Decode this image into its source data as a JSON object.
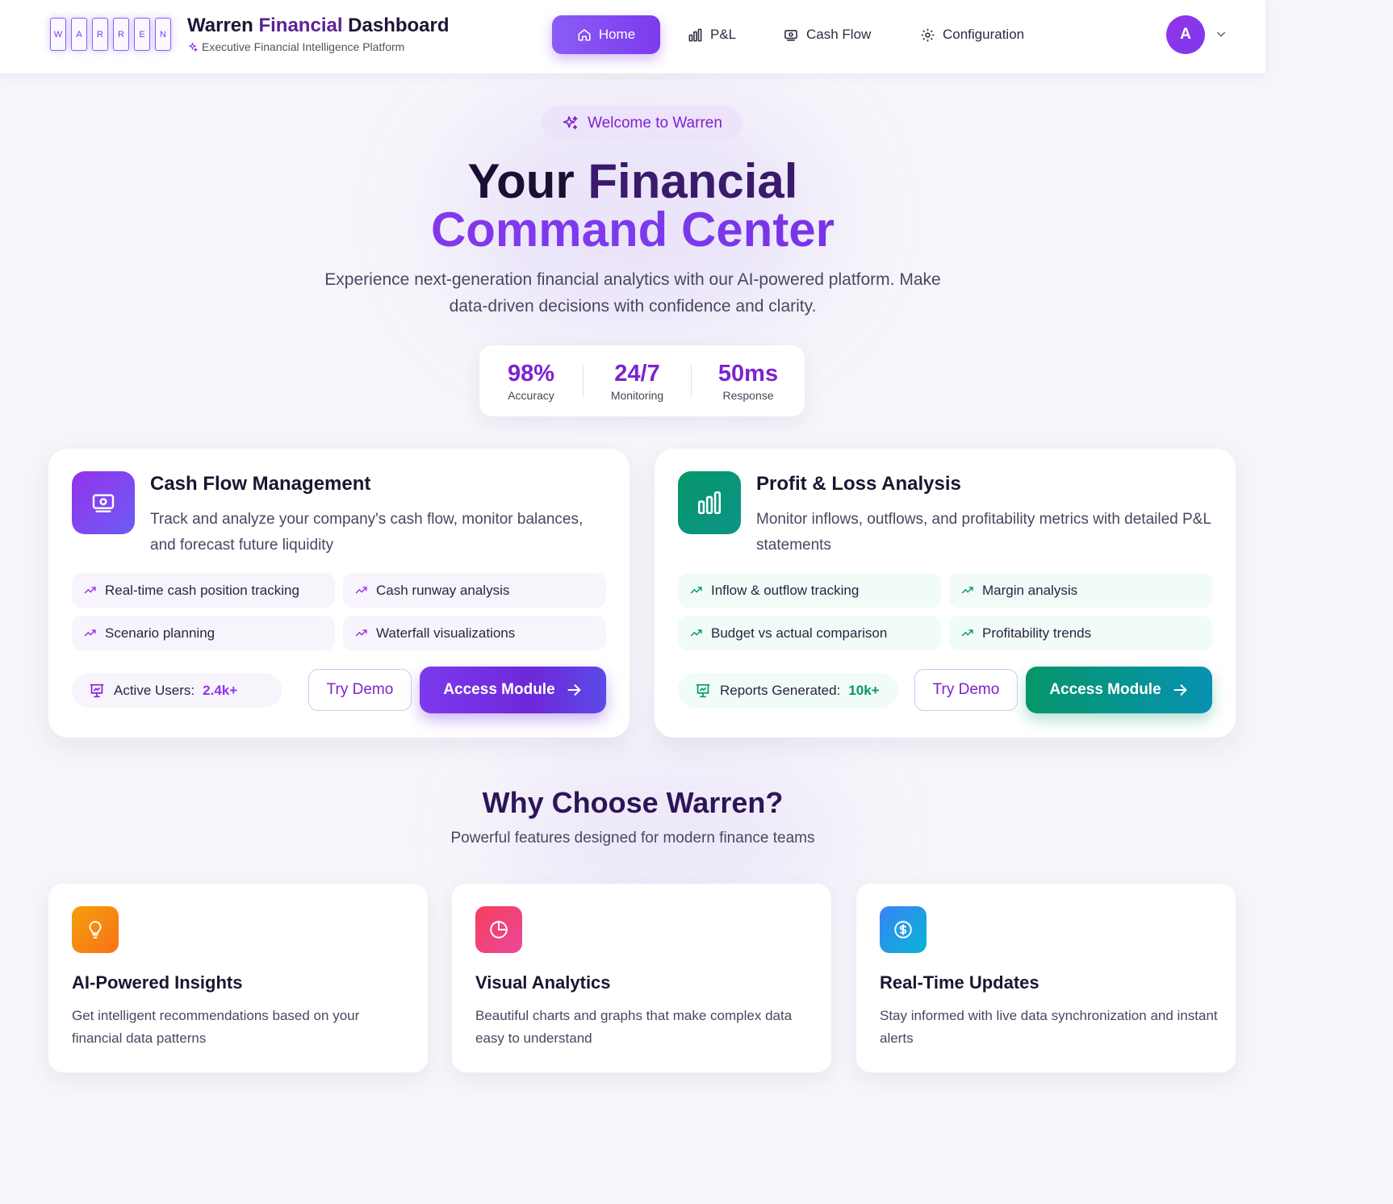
{
  "header": {
    "logo_letters": [
      "W",
      "A",
      "R",
      "R",
      "E",
      "N"
    ],
    "title_part1": "Warren",
    "title_part2": "Financial",
    "title_part3": "Dashboard",
    "subtitle": "Executive Financial Intelligence Platform",
    "nav": [
      {
        "label": "Home",
        "icon": "home-icon",
        "active": true
      },
      {
        "label": "P&L",
        "icon": "bar-chart-icon",
        "active": false
      },
      {
        "label": "Cash Flow",
        "icon": "banknote-icon",
        "active": false
      },
      {
        "label": "Configuration",
        "icon": "gear-icon",
        "active": false
      }
    ],
    "avatar_initial": "A"
  },
  "hero": {
    "badge": "Welcome to Warren",
    "title_line1_a": "Your",
    "title_line1_b": "Financial",
    "title_line2": "Command Center",
    "description": "Experience next-generation financial analytics with our AI-powered platform. Make data-driven decisions with confidence and clarity.",
    "stats": [
      {
        "value": "98%",
        "label": "Accuracy"
      },
      {
        "value": "24/7",
        "label": "Monitoring"
      },
      {
        "value": "50ms",
        "label": "Response"
      }
    ]
  },
  "modules": [
    {
      "title": "Cash Flow Management",
      "description": "Track and analyze your company's cash flow, monitor balances, and forecast future liquidity",
      "features": [
        "Real-time cash position tracking",
        "Cash runway analysis",
        "Scenario planning",
        "Waterfall visualizations"
      ],
      "metric_label": "Active Users:",
      "metric_value": "2.4k+",
      "try_label": "Try Demo",
      "access_label": "Access Module",
      "accent": "#7c3aed"
    },
    {
      "title": "Profit & Loss Analysis",
      "description": "Monitor inflows, outflows, and profitability metrics with detailed P&L statements",
      "features": [
        "Inflow & outflow tracking",
        "Margin analysis",
        "Budget vs actual comparison",
        "Profitability trends"
      ],
      "metric_label": "Reports Generated:",
      "metric_value": "10k+",
      "try_label": "Try Demo",
      "access_label": "Access Module",
      "accent": "#059669"
    }
  ],
  "why": {
    "title": "Why Choose Warren?",
    "subtitle": "Powerful features designed for modern finance teams",
    "features": [
      {
        "title": "AI-Powered Insights",
        "description": "Get intelligent recommendations based on your financial data patterns",
        "icon": "lightbulb-icon"
      },
      {
        "title": "Visual Analytics",
        "description": "Beautiful charts and graphs that make complex data easy to understand",
        "icon": "pie-chart-icon"
      },
      {
        "title": "Real-Time Updates",
        "description": "Stay informed with live data synchronization and instant alerts",
        "icon": "dollar-circle-icon"
      }
    ]
  }
}
